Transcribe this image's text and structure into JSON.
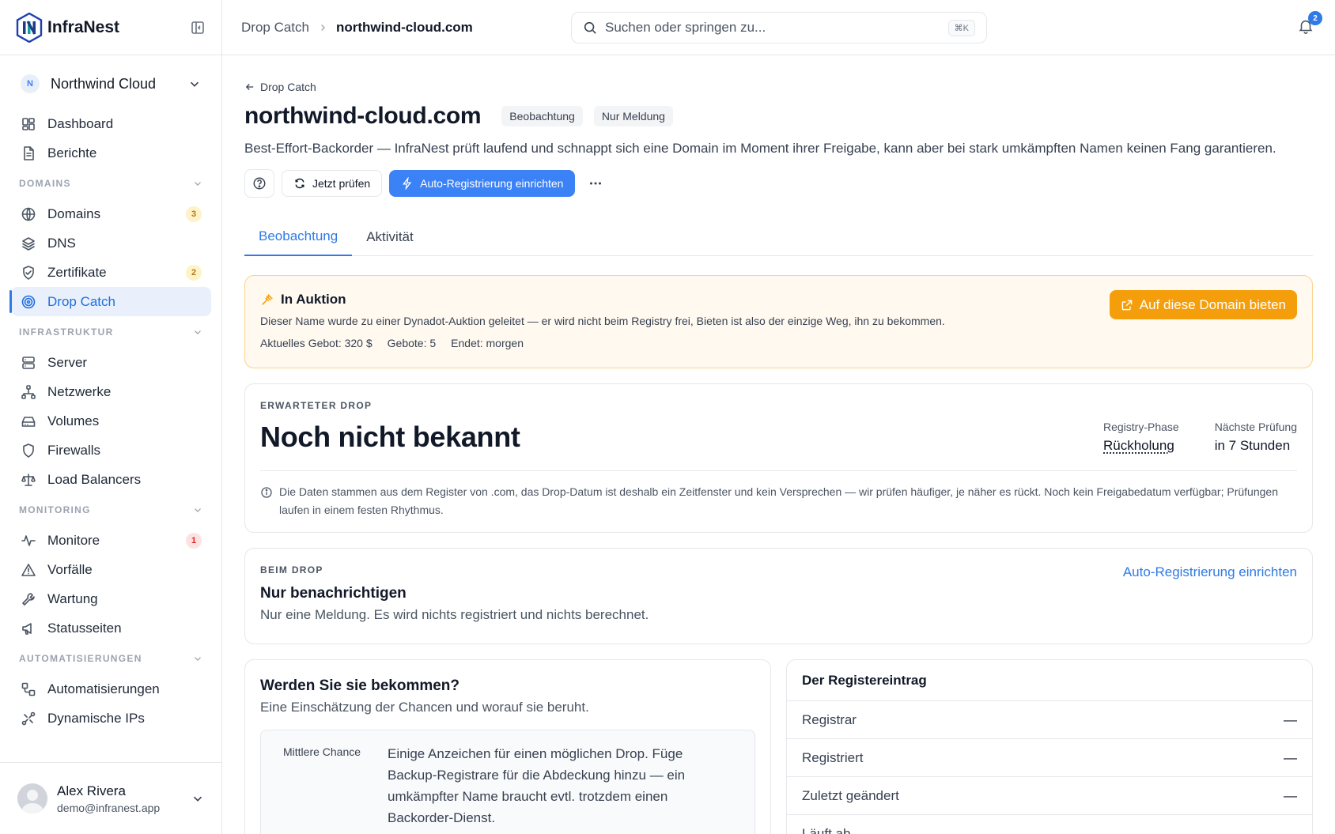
{
  "app": {
    "name": "InfraNest"
  },
  "org": {
    "initial": "N",
    "name": "Northwind Cloud"
  },
  "nav": {
    "top": [
      {
        "label": "Dashboard",
        "icon": "dashboard-icon"
      },
      {
        "label": "Berichte",
        "icon": "file-text-icon"
      }
    ],
    "sections": [
      {
        "title": "DOMAINS",
        "items": [
          {
            "label": "Domains",
            "icon": "globe-icon",
            "badge": "3",
            "badge_color": "amber"
          },
          {
            "label": "DNS",
            "icon": "layers-icon"
          },
          {
            "label": "Zertifikate",
            "icon": "shield-check-icon",
            "badge": "2",
            "badge_color": "amber"
          },
          {
            "label": "Drop Catch",
            "icon": "target-icon",
            "active": true
          }
        ]
      },
      {
        "title": "INFRASTRUKTUR",
        "items": [
          {
            "label": "Server",
            "icon": "server-icon"
          },
          {
            "label": "Netzwerke",
            "icon": "network-icon"
          },
          {
            "label": "Volumes",
            "icon": "hard-drive-icon"
          },
          {
            "label": "Firewalls",
            "icon": "shield-icon"
          },
          {
            "label": "Load Balancers",
            "icon": "scale-icon"
          }
        ]
      },
      {
        "title": "MONITORING",
        "items": [
          {
            "label": "Monitore",
            "icon": "activity-icon",
            "badge": "1",
            "badge_color": "red"
          },
          {
            "label": "Vorfälle",
            "icon": "alert-triangle-icon"
          },
          {
            "label": "Wartung",
            "icon": "wrench-icon"
          },
          {
            "label": "Statusseiten",
            "icon": "megaphone-icon"
          }
        ]
      },
      {
        "title": "AUTOMATISIERUNGEN",
        "items": [
          {
            "label": "Automatisierungen",
            "icon": "workflow-icon"
          },
          {
            "label": "Dynamische IPs",
            "icon": "dynamic-ip-icon"
          }
        ]
      }
    ]
  },
  "user": {
    "name": "Alex Rivera",
    "email": "demo@infranest.app"
  },
  "topbar": {
    "breadcrumb_parent": "Drop Catch",
    "breadcrumb_current": "northwind-cloud.com",
    "search_placeholder": "Suchen oder springen zu...",
    "search_shortcut": "⌘K",
    "notifications": "2"
  },
  "page": {
    "back_label": "Drop Catch",
    "title": "northwind-cloud.com",
    "tags": [
      "Beobachtung",
      "Nur Meldung"
    ],
    "description": "Best-Effort-Backorder — InfraNest prüft laufend und schnappt sich eine Domain im Moment ihrer Freigabe, kann aber bei stark umkämpften Namen keinen Fang garantieren.",
    "check_now": "Jetzt prüfen",
    "auto_register": "Auto-Registrierung einrichten",
    "tabs": [
      "Beobachtung",
      "Aktivität"
    ]
  },
  "auction": {
    "title": "In Auktion",
    "text": "Dieser Name wurde zu einer Dynadot-Auktion geleitet — er wird nicht beim Registry frei, Bieten ist also der einzige Weg, ihn zu bekommen.",
    "current_bid": "Aktuelles Gebot: 320 $",
    "bids": "Gebote: 5",
    "ends": "Endet: morgen",
    "bid_button": "Auf diese Domain bieten"
  },
  "drop": {
    "eyebrow": "ERWARTETER DROP",
    "value": "Noch nicht bekannt",
    "phase_label": "Registry-Phase",
    "phase_value": "Rückholung",
    "next_check_label": "Nächste Prüfung",
    "next_check_value": "in 7 Stunden",
    "note": "Die Daten stammen aus dem Register von .com, das Drop-Datum ist deshalb ein Zeitfenster und kein Versprechen — wir prüfen häufiger, je näher es rückt. Noch kein Freigabedatum verfügbar; Prüfungen laufen in einem festen Rhythmus."
  },
  "on_drop": {
    "eyebrow": "BEIM DROP",
    "title": "Nur benachrichtigen",
    "subtitle": "Nur eine Meldung. Es wird nichts registriert und nichts berechnet.",
    "link": "Auto-Registrierung einrichten"
  },
  "chance": {
    "title": "Werden Sie sie bekommen?",
    "subtitle": "Eine Einschätzung der Chancen und worauf sie beruht.",
    "label": "Mittlere Chance",
    "text": "Einige Anzeichen für einen möglichen Drop. Füge Backup-Registrare für die Abdeckung hinzu — ein umkämpfter Name braucht evtl. trotzdem einen Backorder-Dienst."
  },
  "registry": {
    "title": "Der Registereintrag",
    "rows": [
      {
        "label": "Registrar",
        "value": "—"
      },
      {
        "label": "Registriert",
        "value": "—"
      },
      {
        "label": "Zuletzt geändert",
        "value": "—"
      },
      {
        "label": "Läuft ab",
        "value": "—"
      }
    ]
  },
  "colors": {
    "accent": "#3b82f6",
    "auction": "#f59e0b"
  }
}
